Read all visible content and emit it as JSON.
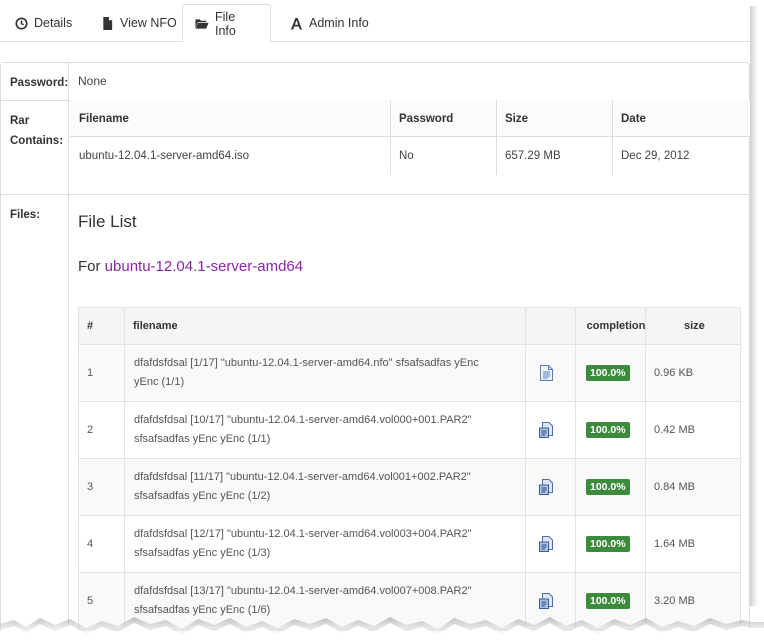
{
  "tabs": [
    {
      "label": "Details",
      "icon": "clock-icon",
      "active": false
    },
    {
      "label": "View NFO",
      "icon": "file-icon",
      "active": false
    },
    {
      "label": "File Info",
      "icon": "folder-open-icon",
      "active": true
    },
    {
      "label": "Admin Info",
      "icon": "font-icon",
      "active": false
    }
  ],
  "password": {
    "label": "Password:",
    "value": "None"
  },
  "rar": {
    "label_line1": "Rar",
    "label_line2": "Contains:",
    "headers": {
      "filename": "Filename",
      "password": "Password",
      "size": "Size",
      "date": "Date"
    },
    "row": {
      "filename": "ubuntu-12.04.1-server-amd64.iso",
      "password": "No",
      "size": "657.29 MB",
      "date": "Dec 29, 2012"
    }
  },
  "files": {
    "label": "Files:",
    "title": "File List",
    "for_prefix": "For",
    "for_link": "ubuntu-12.04.1-server-amd64",
    "headers": {
      "num": "#",
      "filename": "filename",
      "completion": "completion",
      "size": "size"
    },
    "rows": [
      {
        "num": "1",
        "line1": "dfafdsfdsal [1/17] \"ubuntu-12.04.1-server-amd64.nfo\" sfsafsadfas yEnc",
        "line2": "yEnc (1/1)",
        "completion": "100.0%",
        "size": "0.96 KB",
        "icon": "document-icon"
      },
      {
        "num": "2",
        "line1": "dfafdsfdsal [10/17] \"ubuntu-12.04.1-server-amd64.vol000+001.PAR2\"",
        "line2": "sfsafsadfas yEnc yEnc (1/1)",
        "completion": "100.0%",
        "size": "0.42 MB",
        "icon": "par2-icon"
      },
      {
        "num": "3",
        "line1": "dfafdsfdsal [11/17] \"ubuntu-12.04.1-server-amd64.vol001+002.PAR2\"",
        "line2": "sfsafsadfas yEnc yEnc (1/2)",
        "completion": "100.0%",
        "size": "0.84 MB",
        "icon": "par2-icon"
      },
      {
        "num": "4",
        "line1": "dfafdsfdsal [12/17] \"ubuntu-12.04.1-server-amd64.vol003+004.PAR2\"",
        "line2": "sfsafsadfas yEnc yEnc (1/3)",
        "completion": "100.0%",
        "size": "1.64 MB",
        "icon": "par2-icon"
      },
      {
        "num": "5",
        "line1": "dfafdsfdsal [13/17] \"ubuntu-12.04.1-server-amd64.vol007+008.PAR2\"",
        "line2": "sfsafsadfas yEnc yEnc (1/6)",
        "completion": "100.0%",
        "size": "3.20 MB",
        "icon": "par2-icon"
      }
    ]
  },
  "colors": {
    "badge": "#3c8a3c",
    "link": "#8e24aa",
    "border": "#dddddd"
  }
}
